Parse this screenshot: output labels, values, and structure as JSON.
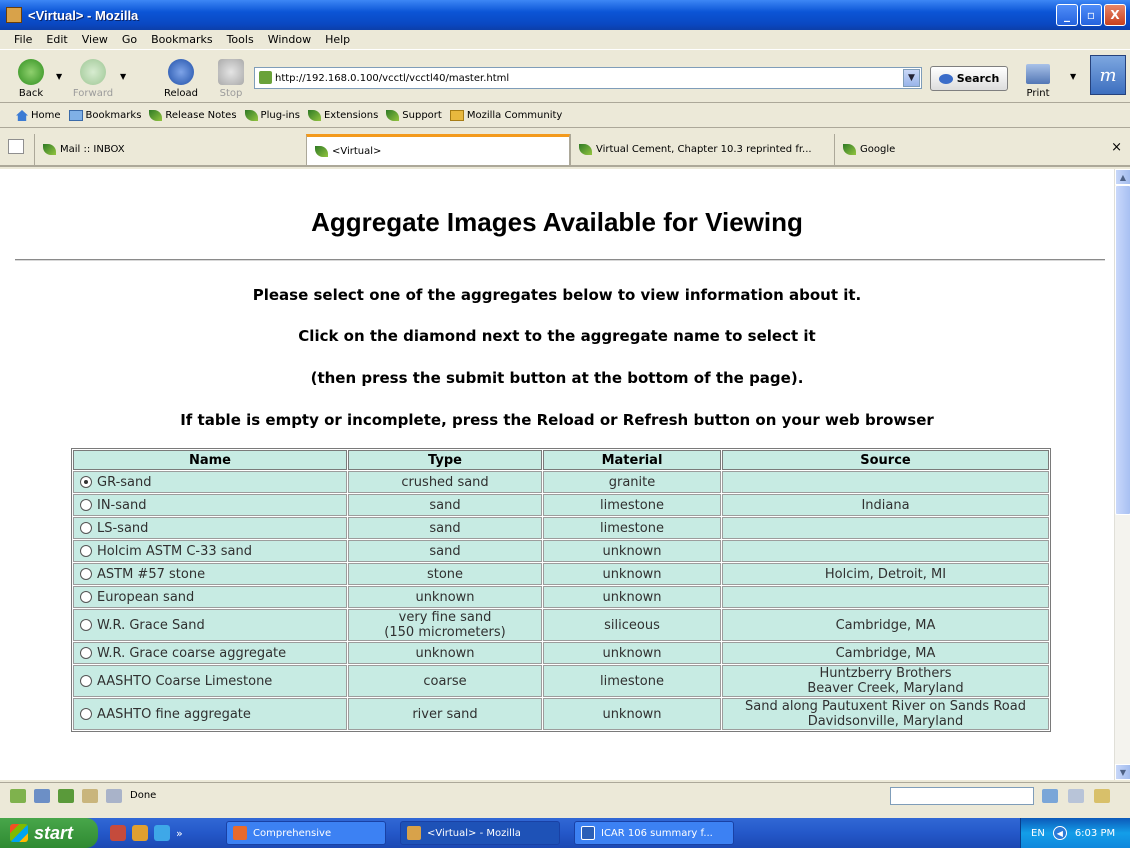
{
  "window": {
    "title": "<Virtual> - Mozilla",
    "min_label": "_",
    "max_label": "▫",
    "close_label": "X"
  },
  "menu": [
    "File",
    "Edit",
    "View",
    "Go",
    "Bookmarks",
    "Tools",
    "Window",
    "Help"
  ],
  "nav": {
    "back": "Back",
    "forward": "Forward",
    "reload": "Reload",
    "stop": "Stop",
    "url": "http://192.168.0.100/vcctl/vcctl40/master.html",
    "search": "Search",
    "print": "Print",
    "logo": "m"
  },
  "bookmarks": [
    "Home",
    "Bookmarks",
    "Release Notes",
    "Plug-ins",
    "Extensions",
    "Support",
    "Mozilla Community"
  ],
  "tabs": [
    "Mail :: INBOX",
    "<Virtual>",
    "Virtual Cement, Chapter 10.3 reprinted fr...",
    "Google"
  ],
  "tab_close": "×",
  "page": {
    "heading": "Aggregate Images Available for Viewing",
    "instructions": [
      "Please select one of the aggregates below to view information about it.",
      "Click on the diamond next to the aggregate name to select it",
      "(then press the submit button at the bottom of the page).",
      "If table is empty or incomplete, press the Reload or Refresh button on your web browser"
    ],
    "columns": [
      "Name",
      "Type",
      "Material",
      "Source"
    ],
    "rows": [
      {
        "name": "GR-sand",
        "type": "crushed sand",
        "material": "granite",
        "source": "",
        "selected": true
      },
      {
        "name": "IN-sand",
        "type": "sand",
        "material": "limestone",
        "source": "Indiana",
        "selected": false
      },
      {
        "name": "LS-sand",
        "type": "sand",
        "material": "limestone",
        "source": "",
        "selected": false
      },
      {
        "name": "Holcim ASTM C-33 sand",
        "type": "sand",
        "material": "unknown",
        "source": "",
        "selected": false
      },
      {
        "name": "ASTM #57 stone",
        "type": "stone",
        "material": "unknown",
        "source": "Holcim, Detroit, MI",
        "selected": false
      },
      {
        "name": "European sand",
        "type": "unknown",
        "material": "unknown",
        "source": "",
        "selected": false
      },
      {
        "name": "W.R. Grace Sand",
        "type": "very fine sand\n(150 micrometers)",
        "material": "siliceous",
        "source": "Cambridge, MA",
        "selected": false
      },
      {
        "name": "W.R. Grace coarse aggregate",
        "type": "unknown",
        "material": "unknown",
        "source": "Cambridge, MA",
        "selected": false
      },
      {
        "name": "AASHTO Coarse Limestone",
        "type": "coarse",
        "material": "limestone",
        "source": "Huntzberry Brothers\nBeaver Creek, Maryland",
        "selected": false
      },
      {
        "name": "AASHTO fine aggregate",
        "type": "river sand",
        "material": "unknown",
        "source": "Sand along Pautuxent River on Sands Road\nDavidsonville, Maryland",
        "selected": false
      }
    ]
  },
  "status": {
    "text": "Done"
  },
  "taskbar": {
    "start": "start",
    "more": "»",
    "items": [
      "Comprehensive",
      "<Virtual> - Mozilla",
      "ICAR 106 summary f..."
    ],
    "lang": "EN",
    "clock": "6:03 PM"
  }
}
